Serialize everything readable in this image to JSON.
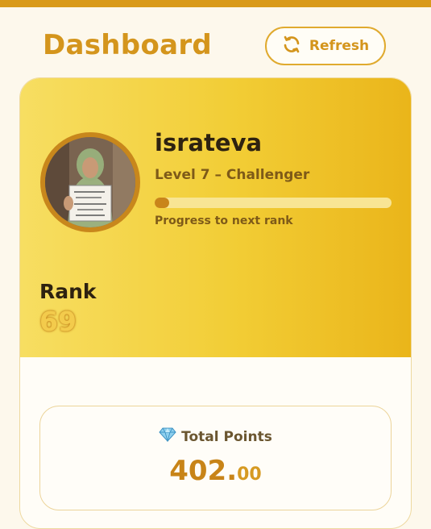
{
  "header": {
    "title": "Dashboard",
    "refresh_label": "Refresh"
  },
  "profile": {
    "username": "israteva",
    "level": "Level 7 – Challenger",
    "progress_fraction": 0.06,
    "progress_label": "Progress to next rank",
    "rank_label": "Rank",
    "rank_value": "69"
  },
  "stats": {
    "points_label": "Total Points",
    "points_integer": "402.",
    "points_decimal": "00"
  },
  "icons": {
    "refresh": "refresh-icon",
    "gem": "gem-icon",
    "avatar": "avatar-photo"
  },
  "colors": {
    "accent": "#d4951c",
    "header_gradient_start": "#f7de62",
    "header_gradient_end": "#eab51a",
    "progress_fill": "#c9851a"
  }
}
